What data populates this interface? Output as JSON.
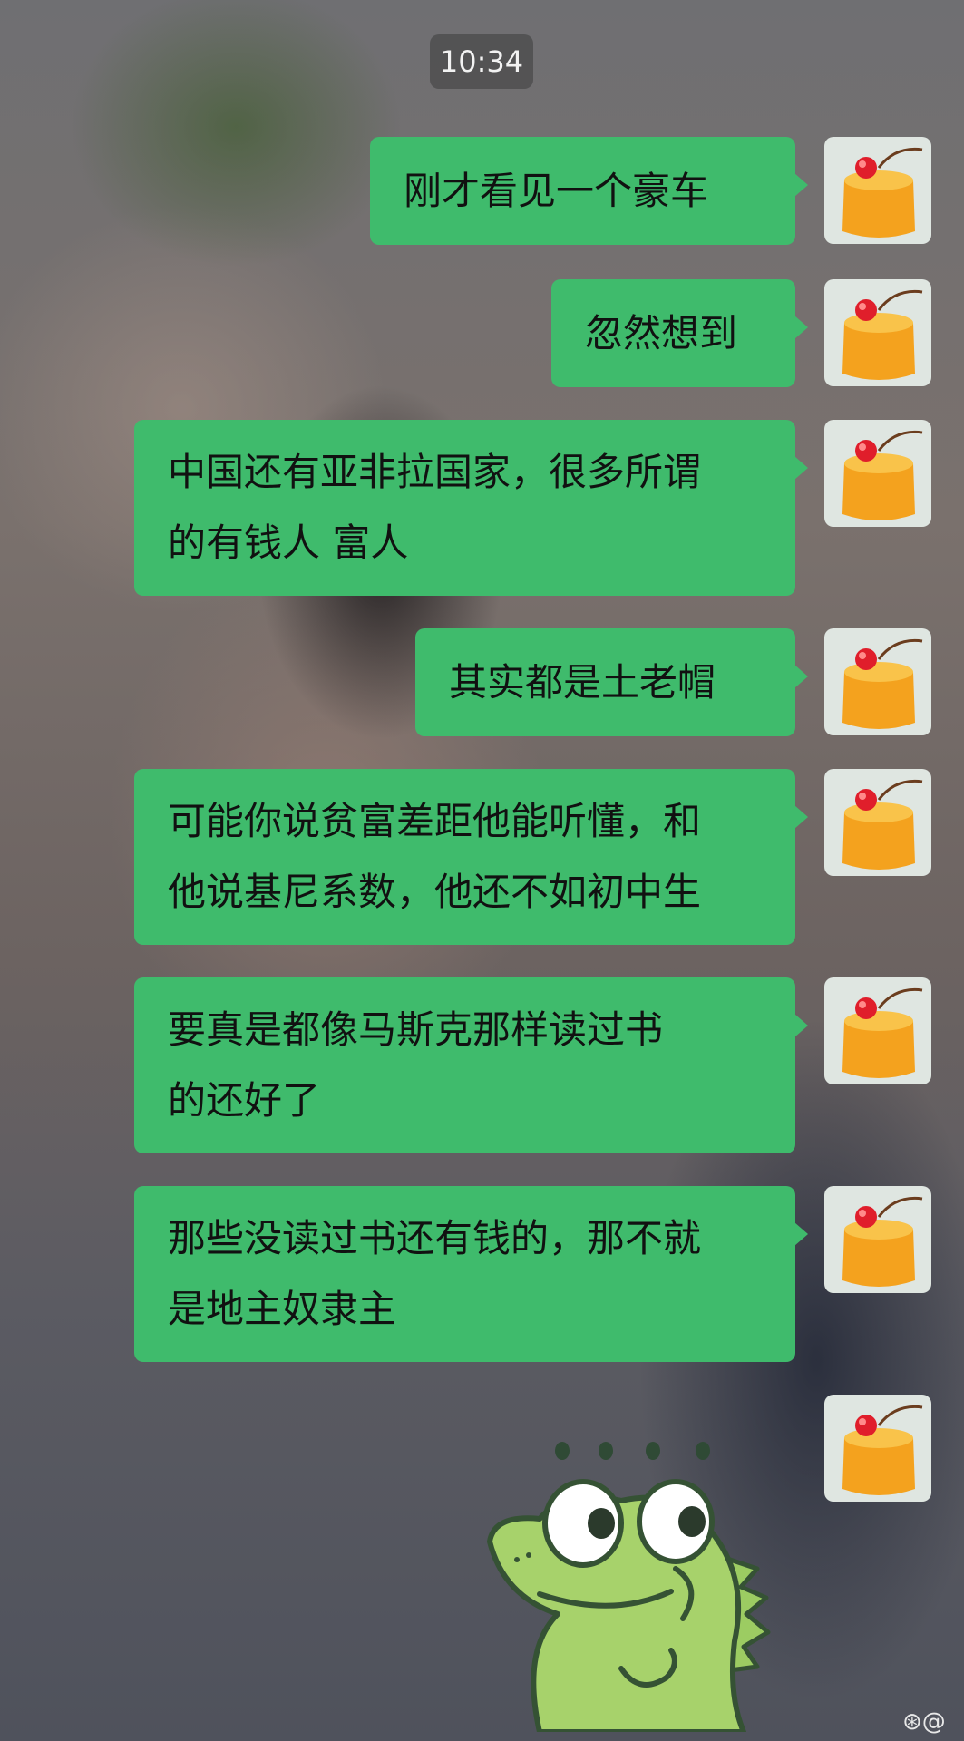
{
  "status": {
    "time": "10:34"
  },
  "chat": {
    "messages": [
      {
        "text": "刚才看见一个豪车"
      },
      {
        "text": "忽然想到"
      },
      {
        "line1": "中国还有亚非拉国家，很多所谓",
        "line2": "的有钱人 富人"
      },
      {
        "text": "其实都是土老帽"
      },
      {
        "line1": "可能你说贫富差距他能听懂，和",
        "line2": "他说基尼系数，他还不如初中生"
      },
      {
        "line1": "要真是都像马斯克那样读过书",
        "line2": "的还好了"
      },
      {
        "line1": "那些没读过书还有钱的，那不就",
        "line2": "是地主奴隶主"
      }
    ],
    "bubble_color": "#3fbb6c",
    "avatar_icon": "pudding-dessert-avatar",
    "sticker_icon": "green-frog-sticker-ellipsis"
  },
  "watermark": {
    "text": "⊛@"
  }
}
